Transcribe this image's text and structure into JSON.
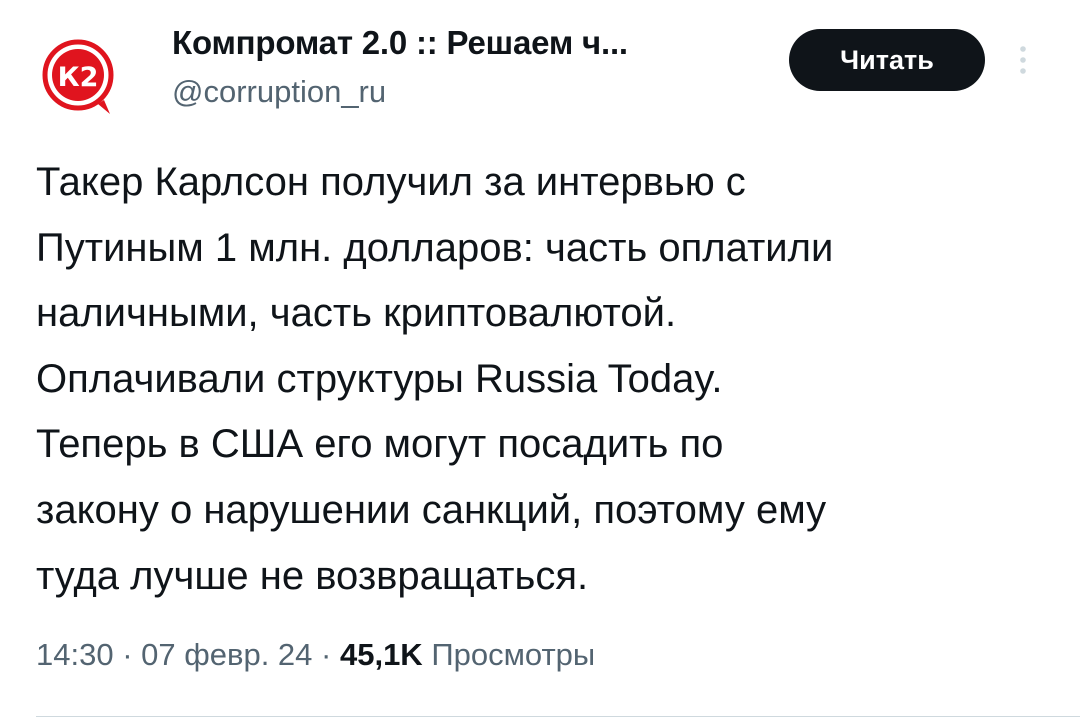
{
  "author": {
    "display_name": "Компромат 2.0 :: Решаем ч...",
    "handle": "@corruption_ru",
    "avatar_text": "К2",
    "avatar_color": "#e0141e"
  },
  "follow_button": {
    "label": "Читать",
    "background": "#0f1419",
    "color": "#ffffff"
  },
  "more_menu": {
    "icon": "vertical-ellipsis-icon"
  },
  "tweet": {
    "lines": [
      "Такер Карлсон получил за интервью с",
      "Путиным 1 млн. долларов: часть оплатили",
      "наличными, часть криптовалютой.",
      "Оплачивали структуры Russia Today.",
      "Теперь в США его могут посадить по",
      "закону о нарушении санкций, поэтому ему",
      "туда лучше не возвращаться."
    ]
  },
  "meta": {
    "time": "14:30",
    "separator1": " · ",
    "date": "07 февр. 24",
    "separator2": " · ",
    "views_count": "45,1K",
    "views_label": " Просмотры"
  },
  "colors": {
    "text_primary": "#0f1419",
    "text_secondary": "#536471",
    "divider": "#cfd9de"
  }
}
